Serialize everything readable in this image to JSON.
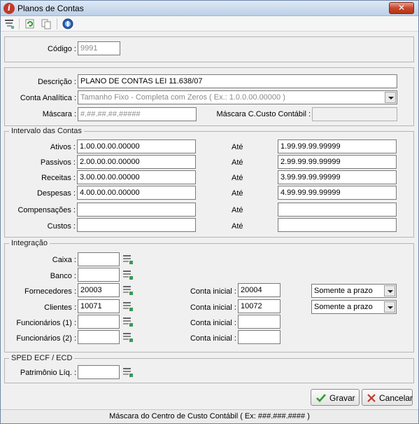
{
  "window": {
    "title": "Planos de Contas",
    "close_glyph": "✕"
  },
  "toolbar": {
    "icons": [
      "filter-icon",
      "refresh-icon",
      "copy-icon",
      "help-icon"
    ]
  },
  "header": {
    "codigo_label": "Código :",
    "codigo_value": "9991"
  },
  "main": {
    "descricao_label": "Descrição :",
    "descricao_value": "PLANO DE CONTAS LEI 11.638/07",
    "conta_analitica_label": "Conta Analítica :",
    "conta_analitica_value": "Tamanho Fixo - Completa com Zeros ( Ex.: 1.0.0.00.00000 )",
    "mascara_label": "Máscara :",
    "mascara_value": "#.##.##.##.#####",
    "mascara_ccusto_label": "Máscara C.Custo Contábil :",
    "mascara_ccusto_value": ""
  },
  "intervalo": {
    "title": "Intervalo das Contas",
    "ate_label": "Até",
    "rows": [
      {
        "label": "Ativos :",
        "from": "1.00.00.00.00000",
        "to": "1.99.99.99.99999"
      },
      {
        "label": "Passivos :",
        "from": "2.00.00.00.00000",
        "to": "2.99.99.99.99999"
      },
      {
        "label": "Receitas :",
        "from": "3.00.00.00.00000",
        "to": "3.99.99.99.99999"
      },
      {
        "label": "Despesas :",
        "from": "4.00.00.00.00000",
        "to": "4.99.99.99.99999"
      },
      {
        "label": "Compensações :",
        "from": "",
        "to": ""
      },
      {
        "label": "Custos :",
        "from": "",
        "to": ""
      }
    ]
  },
  "integracao": {
    "title": "Integração",
    "conta_inicial_label": "Conta inicial :",
    "rows": [
      {
        "label": "Caixa :",
        "value": "",
        "conta_inicial": null,
        "prazo": null
      },
      {
        "label": "Banco :",
        "value": "",
        "conta_inicial": null,
        "prazo": null
      },
      {
        "label": "Fornecedores :",
        "value": "20003",
        "conta_inicial": "20004",
        "prazo": "Somente a prazo"
      },
      {
        "label": "Clientes :",
        "value": "10071",
        "conta_inicial": "10072",
        "prazo": "Somente a prazo"
      },
      {
        "label": "Funcionários (1) :",
        "value": "",
        "conta_inicial": "",
        "prazo": null
      },
      {
        "label": "Funcionários (2) :",
        "value": "",
        "conta_inicial": "",
        "prazo": null
      }
    ]
  },
  "sped": {
    "title": "SPED ECF / ECD",
    "patrimonio_label": "Patrimônio Líq. :",
    "patrimonio_value": ""
  },
  "buttons": {
    "gravar": "Gravar",
    "cancelar": "Cancelar"
  },
  "status": {
    "text": "Máscara do Centro de Custo Contábil ( Ex: ###.###.#### )"
  },
  "colors": {
    "accent_check": "#2e9e2e",
    "cancel_x": "#c0392b",
    "titlebar": "#c9d9ec"
  }
}
